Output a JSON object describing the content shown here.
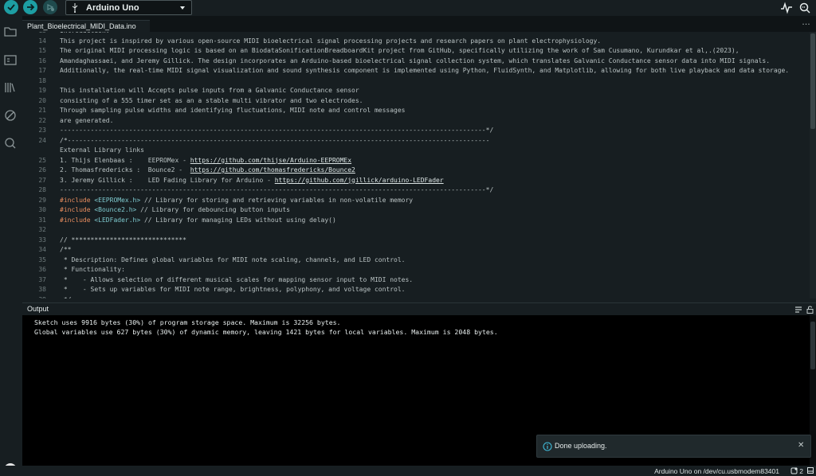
{
  "toolbar": {
    "verify_icon": "check-icon",
    "upload_icon": "arrow-right-icon",
    "debug_icon": "debug-icon",
    "board_name": "Arduino Uno",
    "plotter_icon": "serial-plotter-icon",
    "monitor_icon": "serial-monitor-icon"
  },
  "sidebar": {
    "items": [
      "folder-icon",
      "board-manager-icon",
      "library-manager-icon",
      "debug-icon",
      "search-icon"
    ],
    "account_icon": "account-avatar"
  },
  "tabs": [
    {
      "label": "Plant_Bioelectrical_MIDI_Data.ino"
    }
  ],
  "tab_more": "…",
  "editor": {
    "lines": [
      {
        "n": "13",
        "parts": [
          {
            "t": "Introduction:",
            "c": ""
          }
        ]
      },
      {
        "n": "14",
        "parts": [
          {
            "t": "This project is inspired by various open-source MIDI bioelectrical signal processing projects and research papers on plant electrophysiology.",
            "c": ""
          }
        ]
      },
      {
        "n": "15",
        "parts": [
          {
            "t": "The original MIDI processing logic is based on an BiodataSonificationBreadboardKit project from GitHub, specifically utilizing the work of Sam Cusumano, Kurundkar et al,.(2023),",
            "c": ""
          }
        ]
      },
      {
        "n": "16",
        "parts": [
          {
            "t": "Amandaghassaei, and Jeremy Gillick. The design incorporates an Arduino-based bioelectrical signal collection system, which translates Galvanic Conductance sensor data into MIDI signals.",
            "c": ""
          }
        ]
      },
      {
        "n": "17",
        "parts": [
          {
            "t": "Additionally, the real-time MIDI signal visualization and sound synthesis component is implemented using Python, FluidSynth, and Matplotlib, allowing for both live playback and data storage.",
            "c": ""
          }
        ]
      },
      {
        "n": "18",
        "parts": [
          {
            "t": "",
            "c": ""
          }
        ]
      },
      {
        "n": "19",
        "parts": [
          {
            "t": "This installation will Accepts pulse inputs from a Galvanic Conductance sensor",
            "c": ""
          }
        ]
      },
      {
        "n": "20",
        "parts": [
          {
            "t": "consisting of a 555 timer set as an a stable multi vibrator and two electrodes.",
            "c": ""
          }
        ]
      },
      {
        "n": "21",
        "parts": [
          {
            "t": "Through sampling pulse widths and identifying fluctuations, MIDI note and control messages",
            "c": ""
          }
        ]
      },
      {
        "n": "22",
        "parts": [
          {
            "t": "are generated.",
            "c": ""
          }
        ]
      },
      {
        "n": "23",
        "parts": [
          {
            "t": "---------------------------------------------------------------------------------------------------------------*/",
            "c": ""
          }
        ]
      },
      {
        "n": "24",
        "parts": [
          {
            "t": "/*--------------------------------------------------------------------------------------------------------------",
            "c": ""
          }
        ]
      },
      {
        "n": "",
        "parts": [
          {
            "t": "External Library links",
            "c": ""
          }
        ]
      },
      {
        "n": "25",
        "parts": [
          {
            "t": "1. Thijs Elenbaas :    EEPROMex - ",
            "c": ""
          },
          {
            "t": "https://github.com/thijse/Arduino-EEPROMEx",
            "c": "url"
          }
        ]
      },
      {
        "n": "26",
        "parts": [
          {
            "t": "2. Thomasfredericks :  Bounce2 -  ",
            "c": ""
          },
          {
            "t": "https://github.com/thomasfredericks/Bounce2",
            "c": "url"
          }
        ]
      },
      {
        "n": "27",
        "parts": [
          {
            "t": "3. Jeremy Gillick :    LED Fading Library for Arduino - ",
            "c": ""
          },
          {
            "t": "https://github.com/jgillick/arduino-LEDFader",
            "c": "url"
          }
        ]
      },
      {
        "n": "28",
        "parts": [
          {
            "t": "---------------------------------------------------------------------------------------------------------------*/",
            "c": ""
          }
        ]
      },
      {
        "n": "29",
        "parts": [
          {
            "t": "#include ",
            "c": "kw"
          },
          {
            "t": "<EEPROMex.h>",
            "c": "hdr"
          },
          {
            "t": " // Library for storing and retrieving variables in non-volatile memory",
            "c": ""
          }
        ]
      },
      {
        "n": "30",
        "parts": [
          {
            "t": "#include ",
            "c": "kw"
          },
          {
            "t": "<Bounce2.h>",
            "c": "hdr"
          },
          {
            "t": " // Library for debouncing button inputs",
            "c": ""
          }
        ]
      },
      {
        "n": "31",
        "parts": [
          {
            "t": "#include ",
            "c": "kw"
          },
          {
            "t": "<LEDFader.h>",
            "c": "hdr"
          },
          {
            "t": " // Library for managing LEDs without using delay()",
            "c": ""
          }
        ]
      },
      {
        "n": "32",
        "parts": [
          {
            "t": "",
            "c": ""
          }
        ]
      },
      {
        "n": "33",
        "parts": [
          {
            "t": "// ******************************",
            "c": ""
          }
        ]
      },
      {
        "n": "34",
        "parts": [
          {
            "t": "/**",
            "c": ""
          }
        ]
      },
      {
        "n": "35",
        "parts": [
          {
            "t": " * Description: Defines global variables for MIDI note scaling, channels, and LED control.",
            "c": ""
          }
        ]
      },
      {
        "n": "36",
        "parts": [
          {
            "t": " * Functionality:",
            "c": ""
          }
        ]
      },
      {
        "n": "37",
        "parts": [
          {
            "t": " *    - Allows selection of different musical scales for mapping sensor input to MIDI notes.",
            "c": ""
          }
        ]
      },
      {
        "n": "38",
        "parts": [
          {
            "t": " *    - Sets up variables for MIDI note range, brightness, polyphony, and voltage control.",
            "c": ""
          }
        ]
      },
      {
        "n": "39",
        "parts": [
          {
            "t": " */",
            "c": ""
          }
        ]
      }
    ]
  },
  "output": {
    "title": "Output",
    "lines": [
      "Sketch uses 9916 bytes (30%) of program storage space. Maximum is 32256 bytes.",
      "Global variables use 627 bytes (30%) of dynamic memory, leaving 1421 bytes for local variables. Maximum is 2048 bytes."
    ]
  },
  "notification": {
    "text": "Done uploading.",
    "close": "✕"
  },
  "status": {
    "board_port": "Arduino Uno on /dev/cu.usbmodem83401",
    "notification_count": "2"
  },
  "colors": {
    "accent": "#1d9ea3",
    "keyword": "#e88d5f",
    "header": "#7ec9ce"
  }
}
